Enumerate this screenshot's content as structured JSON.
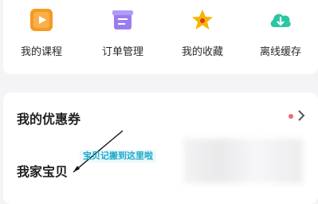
{
  "quick_actions": [
    {
      "label": "我的课程",
      "icon": "course-play-icon",
      "color": "#f59a23"
    },
    {
      "label": "订单管理",
      "icon": "order-doc-icon",
      "color": "#9b7cf0"
    },
    {
      "label": "我的收藏",
      "icon": "star-icon",
      "color": "#f7b500"
    },
    {
      "label": "离线缓存",
      "icon": "download-cloud-icon",
      "color": "#2bc6a3"
    }
  ],
  "coupon": {
    "title": "我的优惠券",
    "dot_color": "#f06a6a"
  },
  "family": {
    "title": "我家宝贝"
  },
  "annotation": {
    "text": "宝贝记搬到这里啦"
  }
}
